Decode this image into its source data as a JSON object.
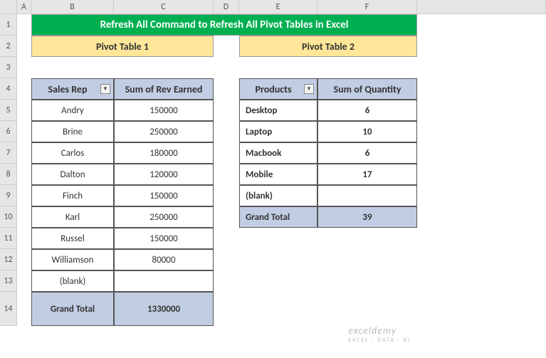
{
  "columns": [
    "A",
    "B",
    "C",
    "D",
    "E",
    "F"
  ],
  "rows": [
    "1",
    "2",
    "3",
    "4",
    "5",
    "6",
    "7",
    "8",
    "9",
    "10",
    "11",
    "12",
    "13",
    "14"
  ],
  "title": "Refresh All Command to Refresh All Pivot Tables in Excel",
  "subtitle1": "Pivot Table 1",
  "subtitle2": "Pivot Table 2",
  "pt1": {
    "h1": "Sales Rep",
    "h2": "Sum of Rev Earned",
    "rows": [
      {
        "k": "Andry",
        "v": "150000"
      },
      {
        "k": "Brine",
        "v": "250000"
      },
      {
        "k": "Carlos",
        "v": "180000"
      },
      {
        "k": "Dalton",
        "v": "120000"
      },
      {
        "k": "Finch",
        "v": "150000"
      },
      {
        "k": "Karl",
        "v": "250000"
      },
      {
        "k": "Russel",
        "v": "150000"
      },
      {
        "k": "Williamson",
        "v": "80000"
      },
      {
        "k": "(blank)",
        "v": ""
      }
    ],
    "gt_label": "Grand Total",
    "gt_value": "1330000"
  },
  "pt2": {
    "h1": "Products",
    "h2": "Sum of Quantity",
    "rows": [
      {
        "k": "Desktop",
        "v": "6"
      },
      {
        "k": "Laptop",
        "v": "10"
      },
      {
        "k": "Macbook",
        "v": "6"
      },
      {
        "k": "Mobile",
        "v": "17"
      },
      {
        "k": "(blank)",
        "v": ""
      }
    ],
    "gt_label": "Grand Total",
    "gt_value": "39"
  },
  "watermark": {
    "brand": "exceldemy",
    "tag": "EXCEL · DATA · BI"
  }
}
